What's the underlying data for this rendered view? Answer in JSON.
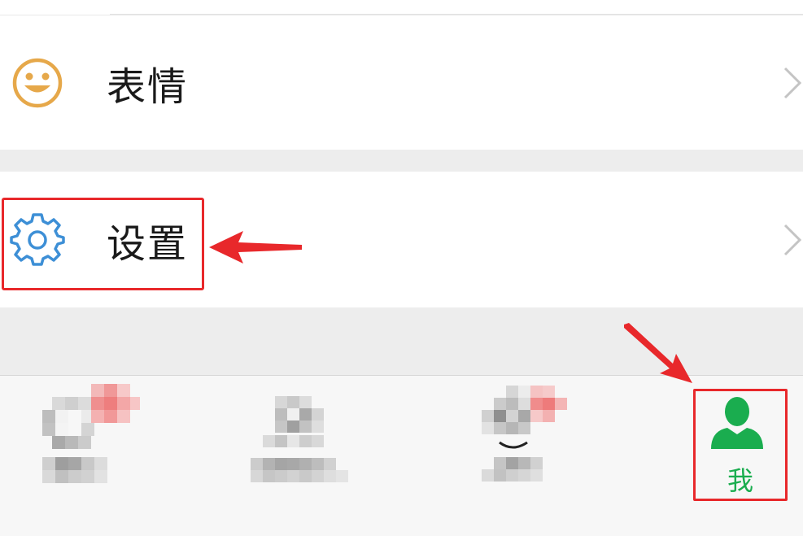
{
  "list": {
    "emoji_label": "表情",
    "settings_label": "设置"
  },
  "tabbar": {
    "me_label": "我"
  },
  "colors": {
    "accent_green": "#1aad4f",
    "emoji_icon": "#e6a84a",
    "settings_icon": "#3d8fd6",
    "annotation_red": "#e8282b"
  },
  "icons": {
    "emoji": "smiley-face-icon",
    "settings": "gear-icon",
    "me": "person-icon",
    "chevron": "chevron-right-icon"
  }
}
